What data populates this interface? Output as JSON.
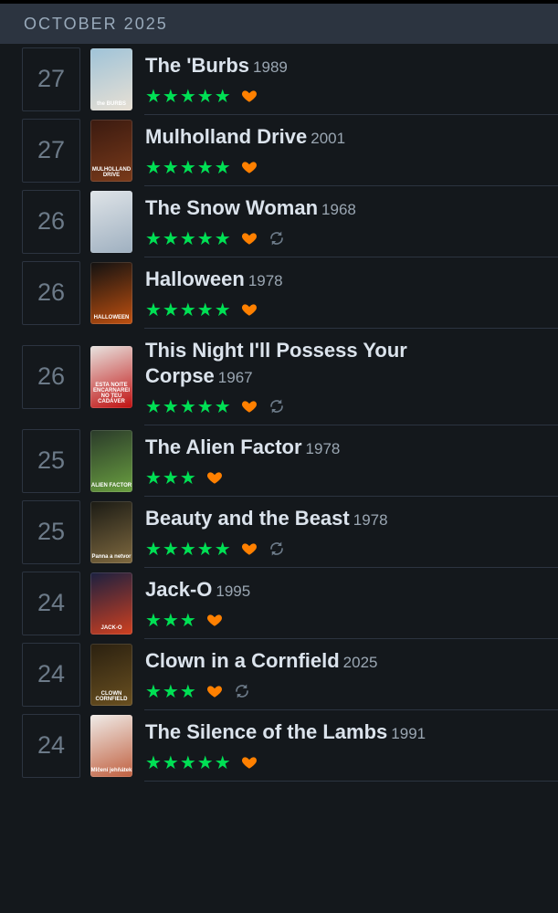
{
  "month_header": "OCTOBER 2025",
  "entries": [
    {
      "day": "27",
      "title": "The 'Burbs",
      "year": "1989",
      "stars": "★★★★★",
      "rewatch": false,
      "poster_colors": [
        "#9fc3d8",
        "#e8e0d4"
      ],
      "poster_label": "the BURBS"
    },
    {
      "day": "27",
      "title": "Mulholland Drive",
      "year": "2001",
      "stars": "★★★★★",
      "rewatch": false,
      "poster_colors": [
        "#3a1a10",
        "#7a3a1a"
      ],
      "poster_label": "MULHOLLAND DRIVE"
    },
    {
      "day": "26",
      "title": "The Snow Woman",
      "year": "1968",
      "stars": "★★★★★",
      "rewatch": true,
      "poster_colors": [
        "#dfe4e8",
        "#9fb0c0"
      ],
      "poster_label": ""
    },
    {
      "day": "26",
      "title": "Halloween",
      "year": "1978",
      "stars": "★★★★★",
      "rewatch": false,
      "poster_colors": [
        "#111111",
        "#c05010"
      ],
      "poster_label": "HALLOWEEN"
    },
    {
      "day": "26",
      "title": "This Night I'll Possess Your Corpse",
      "year": "1967",
      "stars": "★★★★★",
      "rewatch": true,
      "poster_colors": [
        "#e8e4e0",
        "#c01010"
      ],
      "poster_label": "ESTA NOITE ENCARNAREI NO TEU CADÁVER"
    },
    {
      "day": "25",
      "title": "The Alien Factor",
      "year": "1978",
      "stars": "★★★",
      "rewatch": false,
      "poster_colors": [
        "#2a3a2a",
        "#6aa040"
      ],
      "poster_label": "ALIEN FACTOR"
    },
    {
      "day": "25",
      "title": "Beauty and the Beast",
      "year": "1978",
      "stars": "★★★★★",
      "rewatch": true,
      "poster_colors": [
        "#1a1a14",
        "#806a40"
      ],
      "poster_label": "Panna a netvor"
    },
    {
      "day": "24",
      "title": "Jack-O",
      "year": "1995",
      "stars": "★★★",
      "rewatch": false,
      "poster_colors": [
        "#1a2040",
        "#d04020"
      ],
      "poster_label": "JACK-O"
    },
    {
      "day": "24",
      "title": "Clown in a Cornfield",
      "year": "2025",
      "stars": "★★★",
      "rewatch": true,
      "poster_colors": [
        "#2a2010",
        "#6a5020"
      ],
      "poster_label": "CLOWN CORNFIELD"
    },
    {
      "day": "24",
      "title": "The Silence of the Lambs",
      "year": "1991",
      "stars": "★★★★★",
      "rewatch": false,
      "poster_colors": [
        "#f0ece8",
        "#c06040"
      ],
      "poster_label": "Mlčení jehňátek"
    }
  ],
  "colors": {
    "star": "#00e054",
    "heart": "#ff8000",
    "rewatch": "#6c7a88"
  },
  "icons": {
    "liked": "heart-icon",
    "rewatch": "rewatch-icon"
  }
}
